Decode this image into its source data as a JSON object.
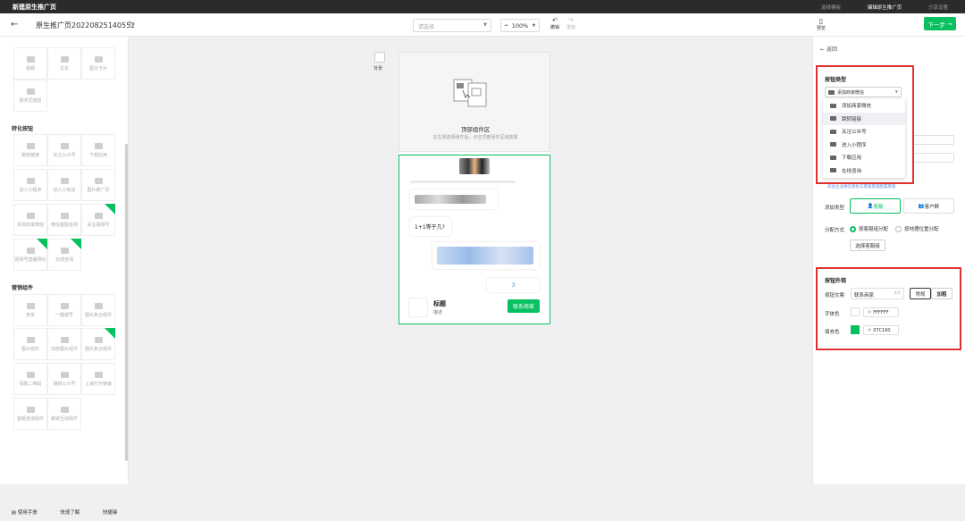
{
  "topbar": {
    "app_title": "新建原生推广页",
    "steps": [
      "选择模板",
      "编辑原生推广页",
      "分享设置"
    ]
  },
  "toolbar": {
    "page_name": "原生推广页20220825140552",
    "select_placeholder": "请选择",
    "zoom": "100%",
    "undo": "撤销",
    "redo": "重做",
    "preview": "预览",
    "next": "下一步"
  },
  "sidebar": {
    "top_items": [
      "视频",
      "文本",
      "图文卡片",
      "悬浮式按钮"
    ],
    "section_convert": "转化按钮",
    "convert_items": [
      "跳转链接",
      "关注公众号",
      "下载应用",
      "进入小程序",
      "进入小商店",
      "图片推广页",
      "添加商家微信",
      "微信客服咨询",
      "关注视频号",
      "视频号直播预约",
      "在线咨询"
    ],
    "section_marketing": "营销组件",
    "marketing_items": [
      "表单",
      "一键拨号",
      "图片复合组件",
      "图片组件",
      "动态图片组件",
      "图片复合组件",
      "领取二维码",
      "跳转公众号",
      "上滑打开链接",
      "客服咨询组件",
      "跳转互动组件"
    ],
    "footer": [
      "使用手册",
      "快速了解",
      "快捷键"
    ]
  },
  "canvas": {
    "bg_label": "背景",
    "top_area_title": "顶部组件区",
    "top_area_sub": "在左侧选择组件后，点击顶部组件区域放置",
    "chat_question": "1+1等于几?",
    "chat_answer": "3",
    "card_title": "标题",
    "card_desc": "描述",
    "contact_button": "联系商家"
  },
  "panel": {
    "back": "返回",
    "button_type_title": "按钮类型",
    "dropdown_value": "添加商家微信",
    "dropdown_options": [
      "添加商家微信",
      "跳转链接",
      "关注公众号",
      "进入小程序",
      "下载应用",
      "在线咨询"
    ],
    "hint_link": "前往企业微信授权与客服管理配置客服",
    "add_type_label": "添加类型",
    "add_type_options": [
      "客服",
      "客户群"
    ],
    "assign_label": "分配方式",
    "assign_options": [
      "按客服组分配",
      "按地理位置分配"
    ],
    "choose_group": "选择客服组",
    "appearance_title": "按钮外观",
    "text_label": "按钮文案",
    "text_value": "联系商家",
    "text_count": "4/5",
    "style_options": [
      "常规",
      "加粗"
    ],
    "font_color_label": "字体色",
    "font_color": "FFFFFF",
    "fill_color_label": "填充色",
    "fill_color": "07C160",
    "accent": "#07c160",
    "highlight": "#e0312f"
  }
}
